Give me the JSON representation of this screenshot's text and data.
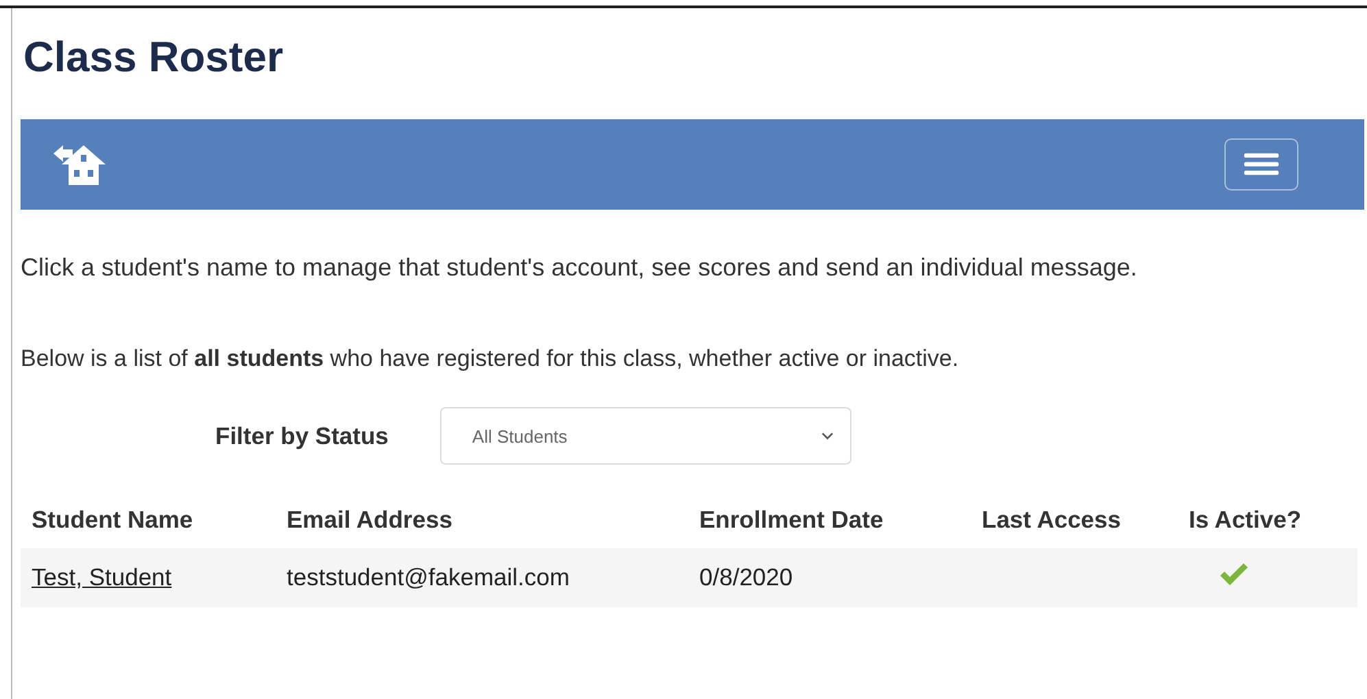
{
  "title": "Class Roster",
  "intro": "Click a student's name to manage that student's account, see scores and send an individual message.",
  "list_note": "Below is a list of **all students** who have registered for this class, whether active or inactive.",
  "filter": {
    "label": "Filter by Status",
    "value": "All Students"
  },
  "table": {
    "columns": [
      "Student Name",
      "Email Address",
      "Enrollment Date",
      "Last Access",
      "Is Active?"
    ],
    "rows": [
      {
        "name": "Test, Student",
        "email": "teststudent@fakemail.com",
        "enrollment_date": "0/8/2020",
        "active": true
      }
    ]
  }
}
